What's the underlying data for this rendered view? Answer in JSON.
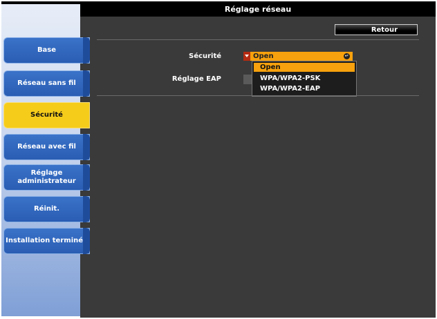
{
  "title": "Réglage réseau",
  "back_button": "Retour",
  "sidebar": {
    "items": [
      {
        "label": "Base"
      },
      {
        "label": "Réseau sans fil"
      },
      {
        "label": "Sécurité"
      },
      {
        "label": "Réseau avec fil"
      },
      {
        "label": "Réglage administrateur"
      },
      {
        "label": "Réinit."
      },
      {
        "label": "Installation terminée"
      }
    ]
  },
  "form": {
    "security_label": "Sécurité",
    "eap_label": "Réglage EAP",
    "security_value": "Open",
    "security_options": [
      "Open",
      "WPA/WPA2-PSK",
      "WPA/WPA2-EAP"
    ]
  },
  "icons": {
    "dropdown_arrow": "chevron-down-icon",
    "enter": "enter-icon"
  },
  "colors": {
    "active_nav": "#f6cc1b",
    "nav_blue": "#2a5db3",
    "highlight": "#f6a10d",
    "main_bg": "#3a3a3a"
  }
}
